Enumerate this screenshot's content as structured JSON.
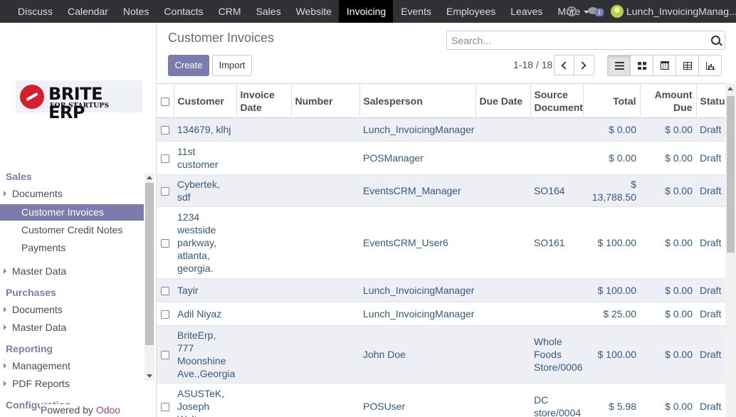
{
  "topbar": {
    "menu": [
      "Discuss",
      "Calendar",
      "Notes",
      "Contacts",
      "CRM",
      "Sales",
      "Website",
      "Invoicing",
      "Events",
      "Employees",
      "Leaves"
    ],
    "active": "Invoicing",
    "more_label": "More",
    "chat_badge": "1",
    "user_name": "Lunch_InvoicingManag..."
  },
  "sidebar": {
    "logo_brand": "BRITE ERP",
    "logo_tagline": "FOR STARTUPS",
    "sales": "Sales",
    "sales_documents": "Documents",
    "customer_invoices": "Customer Invoices",
    "customer_credit_notes": "Customer Credit Notes",
    "payments": "Payments",
    "sales_master_data": "Master Data",
    "purchases": "Purchases",
    "purchases_documents": "Documents",
    "purchases_master_data": "Master Data",
    "reporting": "Reporting",
    "management": "Management",
    "pdf_reports": "PDF Reports",
    "configuration": "Configuration",
    "powered_by": "Powered by ",
    "odoo": "Odoo"
  },
  "control": {
    "title": "Customer Invoices",
    "search_placeholder": "Search...",
    "create": "Create",
    "import": "Import",
    "pager": "1-18 / 18"
  },
  "table": {
    "headers": {
      "customer": "Customer",
      "invoice_date": "Invoice Date",
      "number": "Number",
      "salesperson": "Salesperson",
      "due_date": "Due Date",
      "source_document": "Source Document",
      "total": "Total",
      "amount_due": "Amount Due",
      "status": "Status"
    },
    "rows": [
      {
        "customer": "134679, klhj",
        "salesperson": "Lunch_InvoicingManager",
        "source": "",
        "total": "$ 0.00",
        "due": "$ 0.00",
        "status": "Draft"
      },
      {
        "customer": "11st customer",
        "salesperson": "POSManager",
        "source": "",
        "total": "$ 0.00",
        "due": "$ 0.00",
        "status": "Draft"
      },
      {
        "customer": "Cybertek, sdf",
        "salesperson": "EventsCRM_Manager",
        "source": "SO164",
        "total": "$ 13,788.50",
        "due": "$ 0.00",
        "status": "Draft"
      },
      {
        "customer": "1234 westside parkway, atlanta, georgia.",
        "salesperson": "EventsCRM_User6",
        "source": "SO161",
        "total": "$ 100.00",
        "due": "$ 0.00",
        "status": "Draft"
      },
      {
        "customer": "Tayir",
        "salesperson": "Lunch_InvoicingManager",
        "source": "",
        "total": "$ 100.00",
        "due": "$ 0.00",
        "status": "Draft"
      },
      {
        "customer": "Adil Niyaz",
        "salesperson": "Lunch_InvoicingManager",
        "source": "",
        "total": "$ 25.00",
        "due": "$ 0.00",
        "status": "Draft"
      },
      {
        "customer": "BriteErp, 777 Moonshine Ave.,Georgia",
        "salesperson": "John Doe",
        "source": "Whole Foods Store/0006",
        "total": "$ 100.00",
        "due": "$ 0.00",
        "status": "Draft"
      },
      {
        "customer": "ASUSTeK, Joseph Walters",
        "salesperson": "POSUser",
        "source": "DC store/0004",
        "total": "$ 5.98",
        "due": "$ 0.00",
        "status": "Draft"
      }
    ]
  }
}
